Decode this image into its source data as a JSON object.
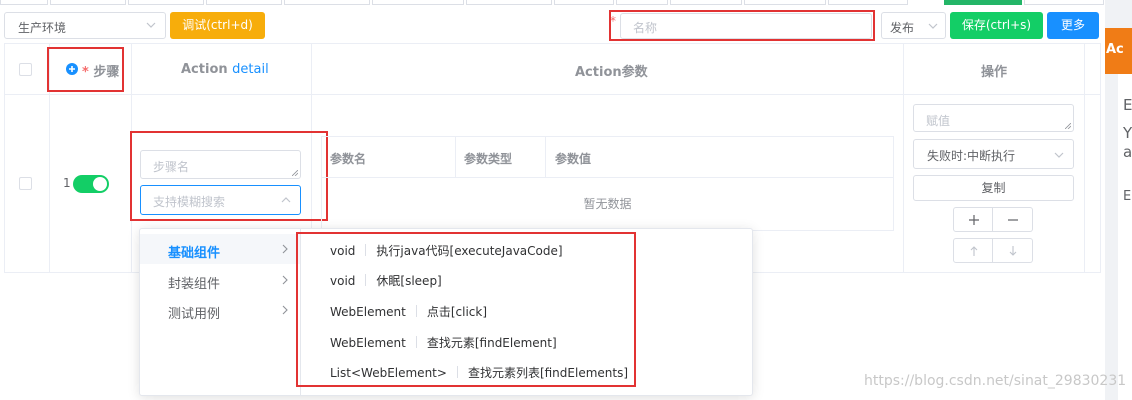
{
  "toolbar": {
    "environment_value": "生产环境",
    "debug_label": "调试(ctrl+d)",
    "name_required_mark": "*",
    "name_placeholder": "名称",
    "publish_value": "发布",
    "save_label": "保存(ctrl+s)",
    "more_label": "更多"
  },
  "table": {
    "headers": {
      "step_required_mark": "*",
      "step": "步骤",
      "action": "Action",
      "action_detail_link": "detail",
      "action_params": "Action参数",
      "operations": "操作"
    },
    "row": {
      "step_number": "1",
      "enabled": true,
      "step_name_placeholder": "步骤名",
      "action_search_placeholder": "支持模糊搜索",
      "params": {
        "columns": [
          "参数名",
          "参数类型",
          "参数值"
        ],
        "empty_text": "暂无数据"
      },
      "ops": {
        "assign_placeholder": "赋值",
        "on_fail_value": "失败时:中断执行",
        "copy_label": "复制"
      }
    }
  },
  "cascader": {
    "categories": [
      {
        "label": "基础组件",
        "active": true
      },
      {
        "label": "封装组件",
        "active": false
      },
      {
        "label": "测试用例",
        "active": false
      }
    ],
    "options": [
      {
        "type": "void",
        "name": "执行java代码[executeJavaCode]"
      },
      {
        "type": "void",
        "name": "休眠[sleep]"
      },
      {
        "type": "WebElement",
        "name": "点击[click]"
      },
      {
        "type": "WebElement",
        "name": "查找元素[findElement]"
      },
      {
        "type": "List<WebElement>",
        "name": "查找元素列表[findElements]"
      }
    ]
  },
  "side_panel": {
    "header_text": "Ac",
    "letters": [
      "E",
      "Y",
      "a",
      "E"
    ]
  },
  "watermark": "https://blog.csdn.net/sinat_29830231",
  "colors": {
    "primary": "#1890ff",
    "success": "#13ce66",
    "warning": "#f7ad0b",
    "danger": "#f56c6c",
    "annotation_red": "#e23333",
    "side_orange": "#f07c16"
  }
}
